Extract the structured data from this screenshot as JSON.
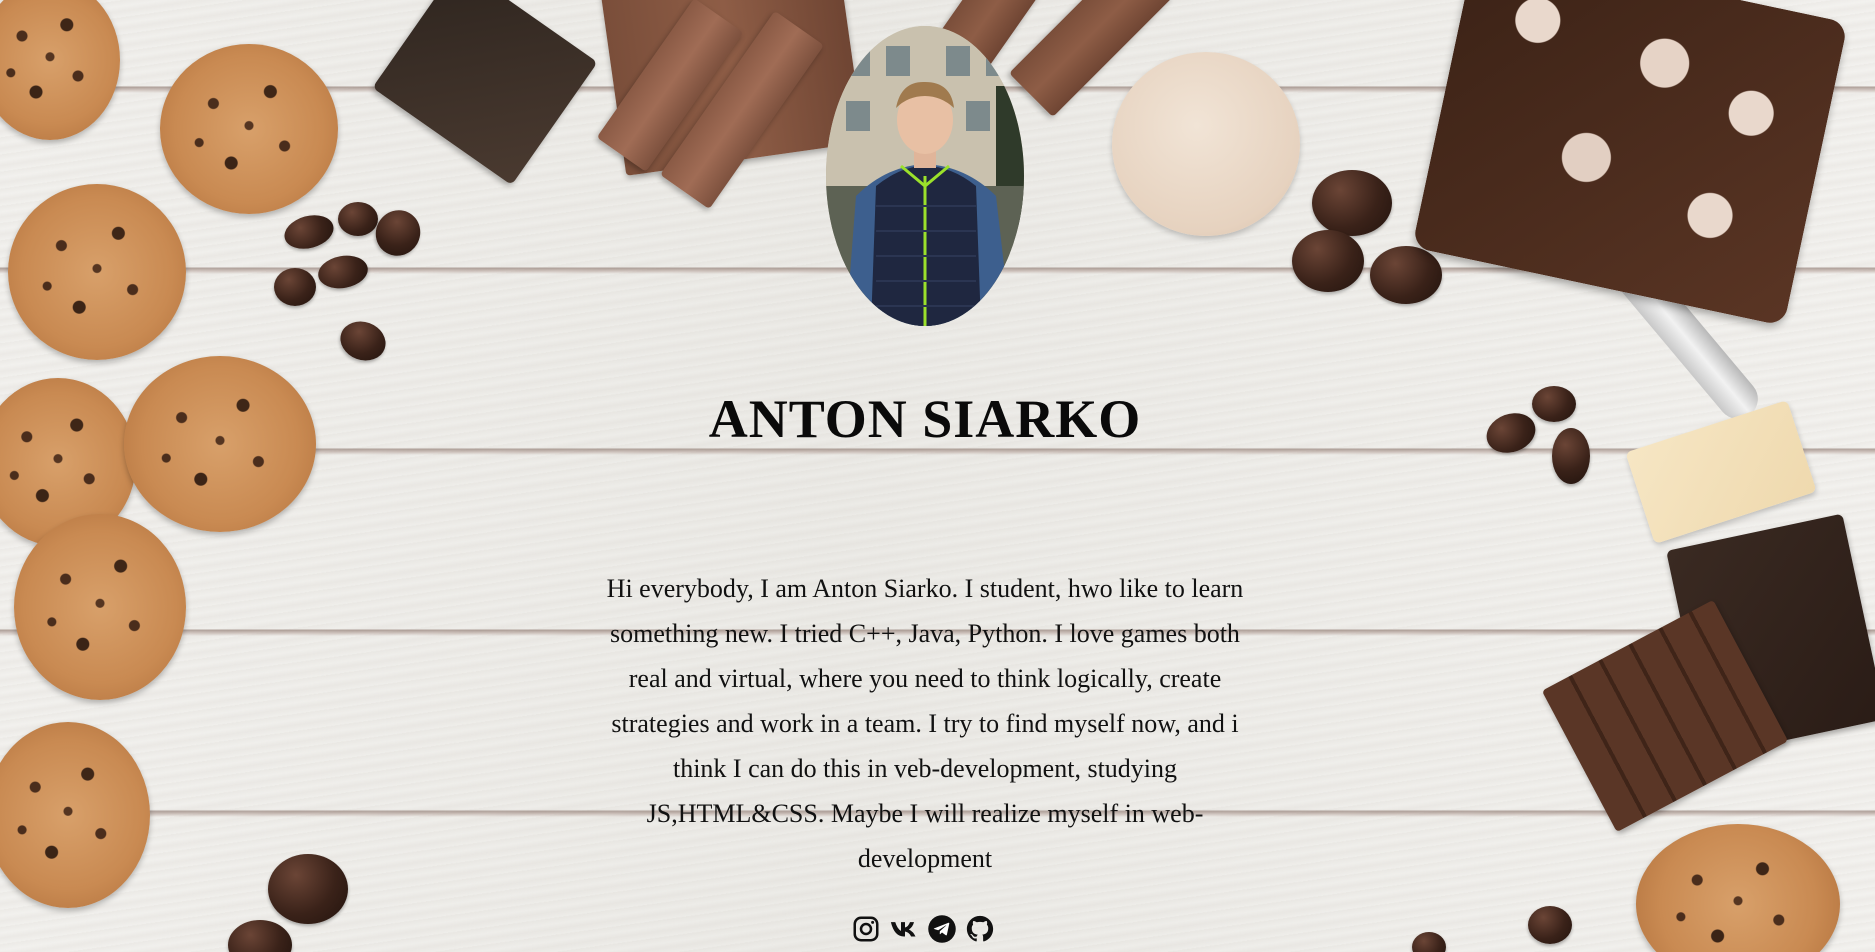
{
  "profile": {
    "name": "ANTON SIARKO",
    "avatar_alt": "portrait photo of Anton Siarko",
    "bio": "Hi everybody, I am Anton Siarko. I student, hwo like to learn something new. I tried C++, Java, Python. I love games both real and virtual, where you need to think logically, create strategies and work in a team. I try to find myself now, and i think I can do this in veb-development, studying JS,HTML&CSS. Maybe I will realize myself in web-development"
  },
  "socials": [
    {
      "icon": "instagram-icon"
    },
    {
      "icon": "vk-icon"
    },
    {
      "icon": "telegram-icon"
    },
    {
      "icon": "github-icon"
    }
  ],
  "colors": {
    "text": "#111111",
    "background": "#ecebe7"
  }
}
